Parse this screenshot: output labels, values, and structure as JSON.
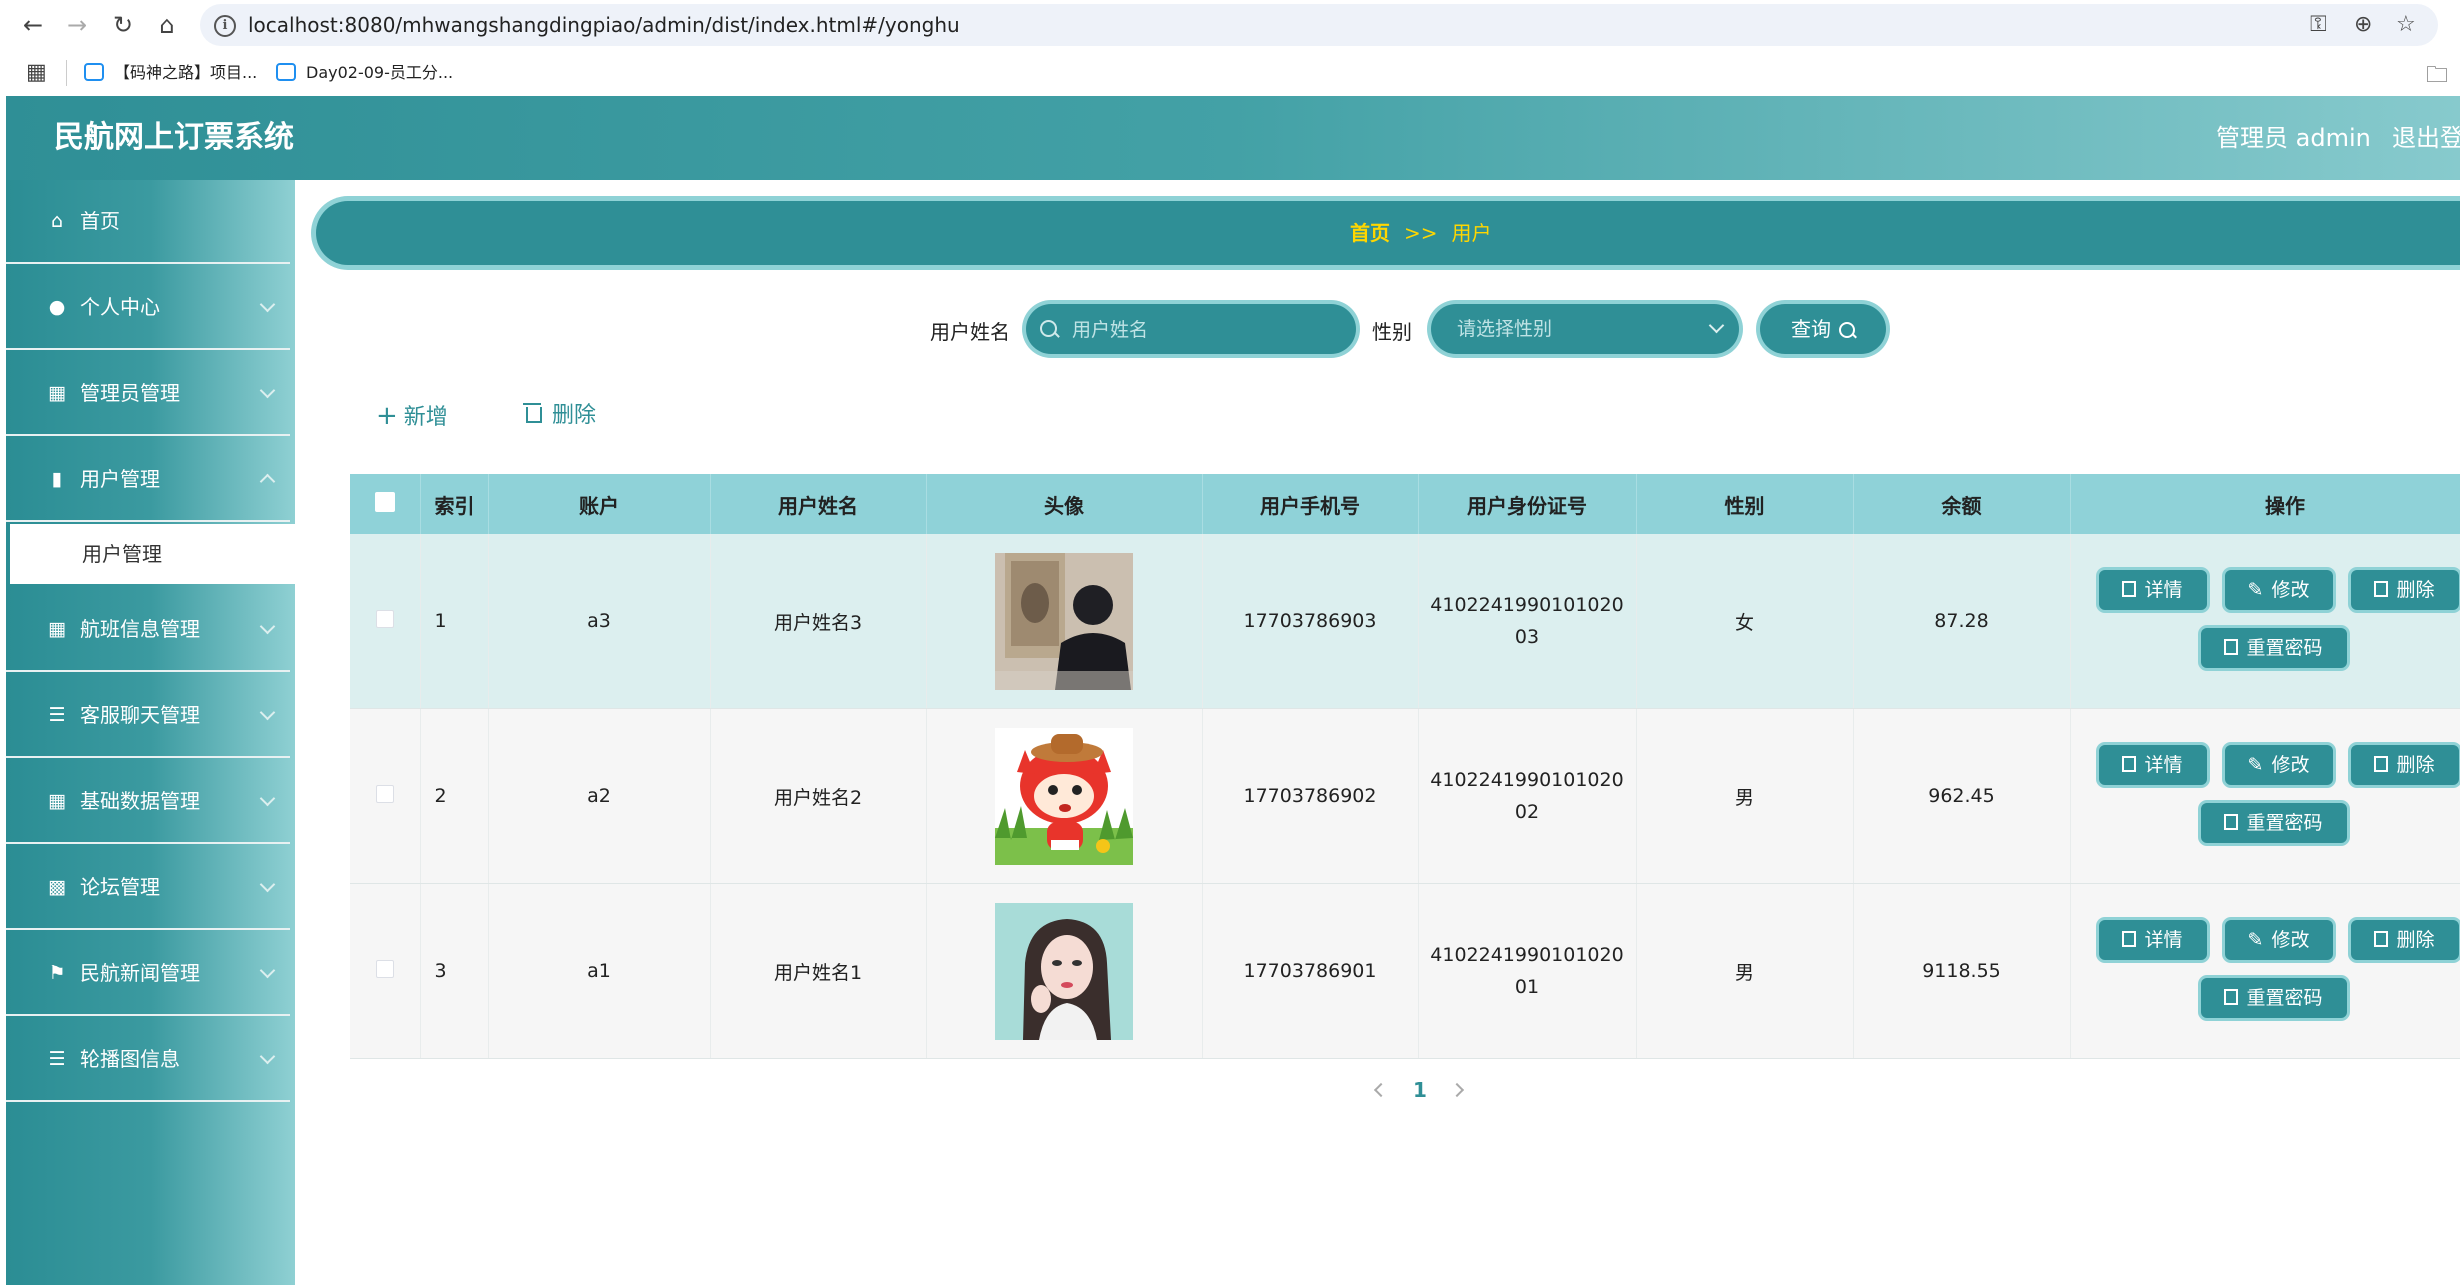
{
  "browser": {
    "url": "localhost:8080/mhwangshangdingpiao/admin/dist/index.html#/yonghu",
    "bookmarks": [
      "【码神之路】项目...",
      "Day02-09-员工分..."
    ]
  },
  "header": {
    "title": "民航网上订票系统",
    "admin_label": "管理员 admin",
    "logout": "退出登录"
  },
  "sidebar": {
    "items": [
      {
        "label": "首页",
        "icon": "home-icon"
      },
      {
        "label": "个人中心",
        "icon": "user-icon"
      },
      {
        "label": "管理员管理",
        "icon": "grid-icon"
      },
      {
        "label": "用户管理",
        "icon": "user-manage-icon"
      },
      {
        "label": "航班信息管理",
        "icon": "grid-icon"
      },
      {
        "label": "客服聊天管理",
        "icon": "list-icon"
      },
      {
        "label": "基础数据管理",
        "icon": "grid-icon"
      },
      {
        "label": "论坛管理",
        "icon": "clipboard-icon"
      },
      {
        "label": "民航新闻管理",
        "icon": "flag-icon"
      },
      {
        "label": "轮播图信息",
        "icon": "list-icon"
      }
    ],
    "active_sub": "用户管理"
  },
  "breadcrumb": {
    "home": "首页",
    "sep": ">>",
    "current": "用户"
  },
  "search": {
    "name_label": "用户姓名",
    "name_placeholder": "用户姓名",
    "gender_label": "性别",
    "gender_placeholder": "请选择性别",
    "query_label": "查询"
  },
  "toolbar": {
    "add_label": "新增",
    "delete_label": "删除"
  },
  "table": {
    "headers": [
      "索引",
      "账户",
      "用户姓名",
      "头像",
      "用户手机号",
      "用户身份证号",
      "性别",
      "余额",
      "操作"
    ],
    "rows": [
      {
        "index": "1",
        "account": "a3",
        "name": "用户姓名3",
        "avatar": "avatar-photo-person",
        "phone": "17703786903",
        "id_line1": "4102241990101020",
        "id_line2": "03",
        "gender": "女",
        "balance": "87.28"
      },
      {
        "index": "2",
        "account": "a2",
        "name": "用户姓名2",
        "avatar": "avatar-cartoon-fox",
        "phone": "17703786902",
        "id_line1": "4102241990101020",
        "id_line2": "02",
        "gender": "男",
        "balance": "962.45"
      },
      {
        "index": "3",
        "account": "a1",
        "name": "用户姓名1",
        "avatar": "avatar-photo-girl",
        "phone": "17703786901",
        "id_line1": "4102241990101020",
        "id_line2": "01",
        "gender": "男",
        "balance": "9118.55"
      }
    ],
    "actions": {
      "detail": "详情",
      "edit": "修改",
      "delete": "删除",
      "reset": "重置密码"
    }
  },
  "pagination": {
    "current": "1"
  },
  "colors": {
    "primary": "#2f8f96",
    "accent_border": "#8fd2d6",
    "header_row": "#8fd2d8",
    "breadcrumb_text": "#ffd700"
  }
}
